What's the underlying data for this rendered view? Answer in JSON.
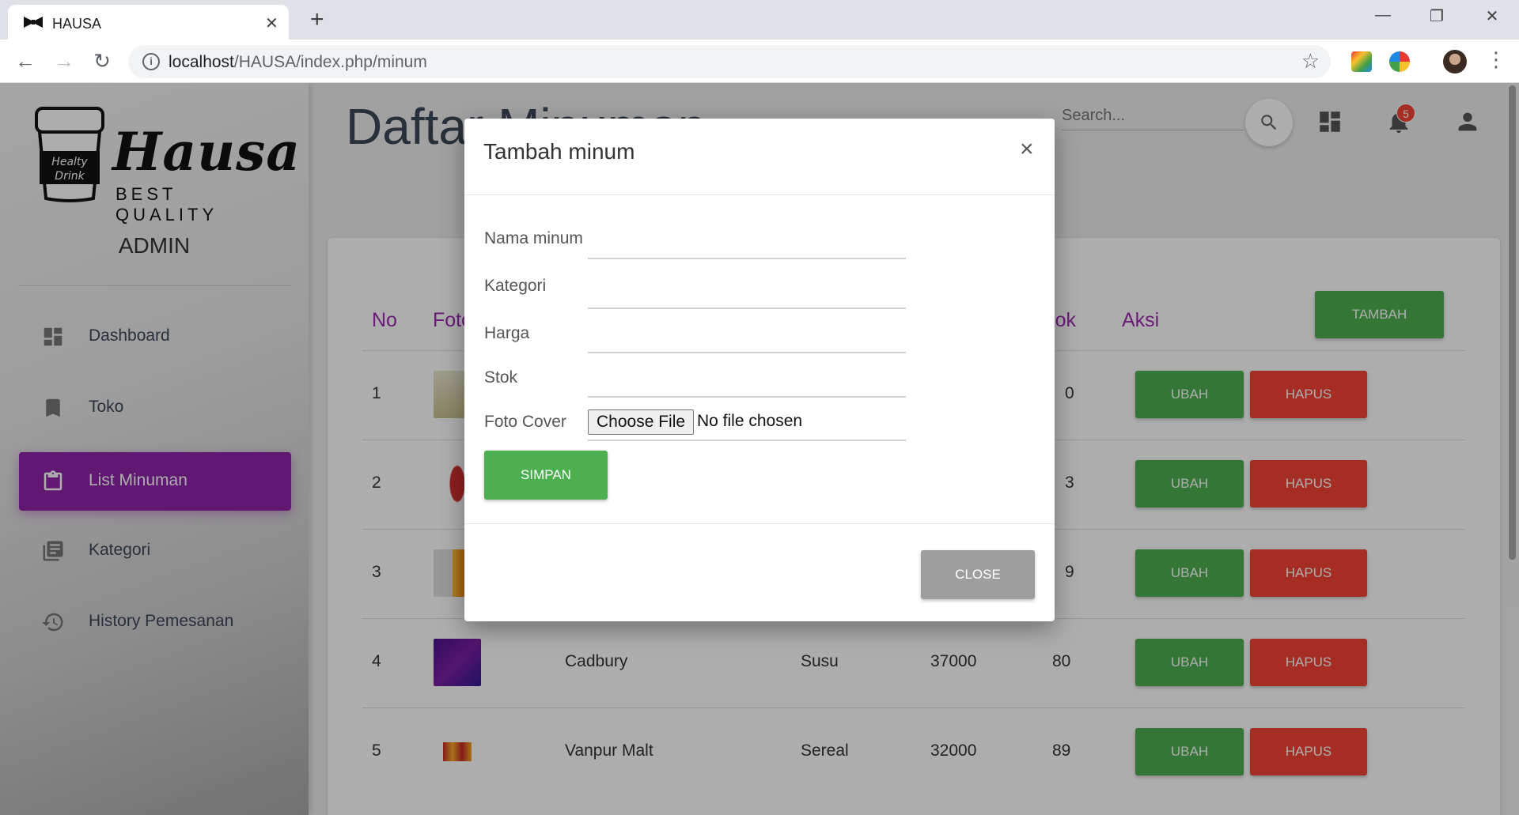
{
  "browser": {
    "tab_title": "HAUSA",
    "url_host": "localhost",
    "url_path": "/HAUSA/index.php/minum"
  },
  "sidebar": {
    "logo_word": "Hausa",
    "logo_tag": "BEST QUALITY",
    "logo_cup_text": "Healty Drink",
    "role": "ADMIN",
    "items": [
      {
        "label": "Dashboard",
        "icon": "dashboard-icon"
      },
      {
        "label": "Toko",
        "icon": "bookmark-icon"
      },
      {
        "label": "List Minuman",
        "icon": "clipboard-icon",
        "active": true
      },
      {
        "label": "Kategori",
        "icon": "list-icon"
      },
      {
        "label": "History Pemesanan",
        "icon": "history-icon"
      }
    ]
  },
  "header": {
    "title": "Daftar Minuman",
    "search_placeholder": "Search...",
    "notification_count": "5"
  },
  "table": {
    "headers": {
      "no": "No",
      "foto": "Foto",
      "stok": "Stok",
      "aksi": "Aksi"
    },
    "add_button": "TAMBAH",
    "edit_label": "UBAH",
    "delete_label": "HAPUS",
    "rows": [
      {
        "no": "1",
        "nama": "",
        "kategori": "",
        "harga": "",
        "stok": "0"
      },
      {
        "no": "2",
        "nama": "",
        "kategori": "",
        "harga": "",
        "stok": "3"
      },
      {
        "no": "3",
        "nama": "",
        "kategori": "",
        "harga": "",
        "stok": "9"
      },
      {
        "no": "4",
        "nama": "Cadbury",
        "kategori": "Susu",
        "harga": "37000",
        "stok": "80"
      },
      {
        "no": "5",
        "nama": "Vanpur Malt",
        "kategori": "Sereal",
        "harga": "32000",
        "stok": "89"
      }
    ]
  },
  "modal": {
    "title": "Tambah minum",
    "close_x": "×",
    "fields": {
      "nama": {
        "label": "Nama minum",
        "value": ""
      },
      "kategori": {
        "label": "Kategori",
        "value": ""
      },
      "harga": {
        "label": "Harga",
        "value": ""
      },
      "stok": {
        "label": "Stok",
        "value": ""
      },
      "foto": {
        "label": "Foto Cover",
        "button": "Choose File",
        "status": "No file chosen"
      }
    },
    "save_label": "SIMPAN",
    "close_label": "CLOSE"
  },
  "colors": {
    "accent_purple": "#9c27b0",
    "success_green": "#4caf50",
    "danger_red": "#f44336",
    "neutral_gray": "#9e9e9e"
  }
}
